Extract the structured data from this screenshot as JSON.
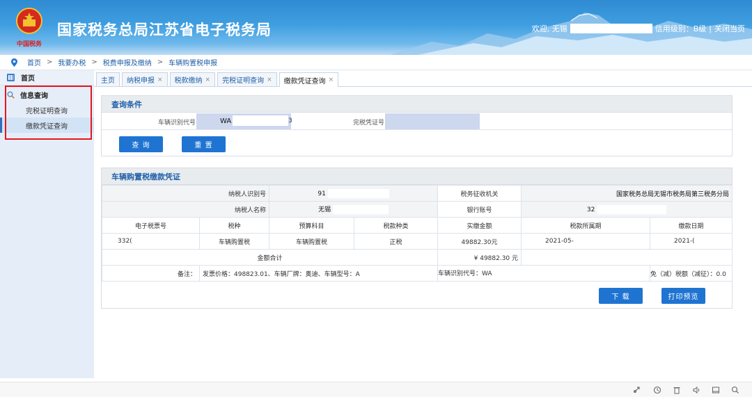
{
  "header": {
    "site_title": "国家税务总局江苏省电子税务局",
    "brand_sub": "中国税务",
    "welcome": "欢迎, 无锡",
    "credit": "信用级别：B级",
    "divider": "|",
    "close_link": "关闭当页"
  },
  "breadcrumb": {
    "items": [
      "首页",
      "我要办税",
      "税费申报及缴纳",
      "车辆购置税申报"
    ],
    "separator": ">"
  },
  "sidebar": {
    "home": "首页",
    "group": "信息查询",
    "items": [
      {
        "label": "完税证明查询",
        "active": false
      },
      {
        "label": "缴款凭证查询",
        "active": true
      }
    ]
  },
  "tabs": [
    {
      "label": "主页",
      "closable": false,
      "active": false
    },
    {
      "label": "纳税申报",
      "closable": true,
      "active": false
    },
    {
      "label": "税款缴纳",
      "closable": true,
      "active": false
    },
    {
      "label": "完税证明查询",
      "closable": true,
      "active": false
    },
    {
      "label": "缴款凭证查询",
      "closable": true,
      "active": true
    }
  ],
  "query": {
    "title": "查询条件",
    "vin_label": "车辆识别代号",
    "vin_value": "WA",
    "vin_tail": "3",
    "cert_label": "完税凭证号",
    "query_button": "查 询",
    "reset_button": "重 置"
  },
  "certificate": {
    "title": "车辆购置税缴款凭证",
    "taxpayer_id_label": "纳税人识别号",
    "taxpayer_id_value": "91",
    "authority_label": "税务征收机关",
    "authority_value": "国家税务总局无锡市税务局第三税务分局",
    "taxpayer_name_label": "纳税人名称",
    "taxpayer_name_value": "无锡",
    "bank_account_label": "银行账号",
    "bank_account_value": "32",
    "columns": [
      "电子税票号",
      "税种",
      "预算科目",
      "税款种类",
      "实缴金额",
      "税款所属期",
      "缴款日期"
    ],
    "row": [
      "332(",
      "车辆购置税",
      "车辆购置税",
      "正税",
      "49882.30元",
      "2021-05-",
      "2021-("
    ],
    "total_label": "金额合计",
    "total_value": "¥ 49882.30 元",
    "remark_label": "备注：",
    "remark_text": "发票价格：498823.01、车辆厂牌：奥迪、车辆型号：A",
    "remark_vin": "车辆识别代号：WA",
    "remark_tax": "免（减）税额（减征）：0.0",
    "download_button": "下 载",
    "print_button": "打印预览"
  },
  "colors": {
    "accent": "#1f74d2",
    "link": "#1f5fa8",
    "highlight_border": "#e8141c"
  },
  "footer_icons": [
    "rocket-icon",
    "refresh-icon",
    "trash-icon",
    "speaker-icon",
    "panel-icon",
    "window-icon",
    "search-icon"
  ]
}
